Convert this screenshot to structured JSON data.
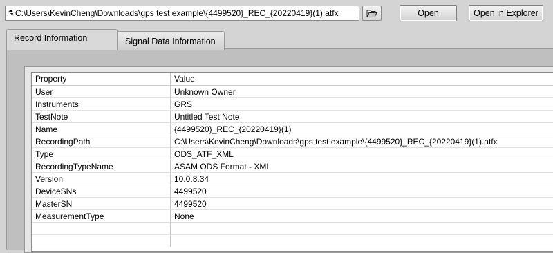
{
  "toolbar": {
    "path_prefix": "⚗",
    "file_path": "C:\\Users\\KevinCheng\\Downloads\\gps test example\\{4499520}_REC_{20220419}(1).atfx",
    "browse_icon": "folder-open-icon",
    "open_label": "Open",
    "open_in_explorer_label": "Open in Explorer"
  },
  "tabs": [
    {
      "label": "Record Information",
      "active": true
    },
    {
      "label": "Signal Data Information",
      "active": false
    }
  ],
  "table": {
    "headers": [
      "Property",
      "Value"
    ],
    "rows": [
      [
        "User",
        "Unknown Owner"
      ],
      [
        "Instruments",
        "GRS"
      ],
      [
        "TestNote",
        "Untitled Test Note"
      ],
      [
        "Name",
        "{4499520}_REC_{20220419}(1)"
      ],
      [
        "RecordingPath",
        "C:\\Users\\KevinCheng\\Downloads\\gps test example\\{4499520}_REC_{20220419}(1).atfx"
      ],
      [
        "Type",
        "ODS_ATF_XML"
      ],
      [
        "RecordingTypeName",
        "ASAM ODS Format - XML"
      ],
      [
        "Version",
        "10.0.8.34"
      ],
      [
        "DeviceSNs",
        "4499520"
      ],
      [
        "MasterSN",
        "4499520"
      ],
      [
        "MeasurementType",
        "None"
      ],
      [
        "",
        ""
      ],
      [
        "",
        ""
      ]
    ]
  }
}
